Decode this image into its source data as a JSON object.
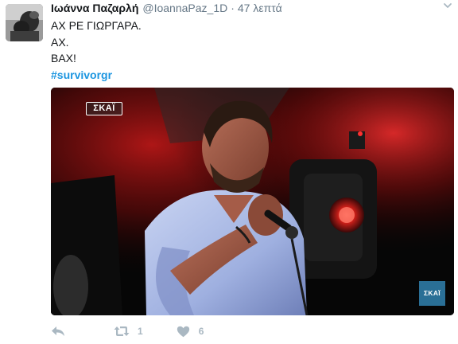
{
  "tweet": {
    "fullname": "Ιωάννα Παζαρλή",
    "username": "@IoannaPaz_1D",
    "separator": "·",
    "time": "47 λεπτά",
    "text_lines": [
      "ΑΧ ΡΕ ΓΙΩΡΓΑΡΑ.",
      "ΑΧ.",
      "ΒΑΧ!"
    ],
    "hashtag": "#survivorgr",
    "media": {
      "logo_top": "ΣΚΑΪ",
      "logo_bottom": "ΣΚΑΪ"
    },
    "actions": {
      "reply_icon": "reply-icon",
      "retweet_icon": "retweet-icon",
      "retweet_count": "1",
      "like_icon": "heart-icon",
      "like_count": "6"
    },
    "colors": {
      "name": "#14171a",
      "meta": "#657786",
      "hashtag": "#1b95e0",
      "action_icons": "#aab8c2"
    }
  }
}
